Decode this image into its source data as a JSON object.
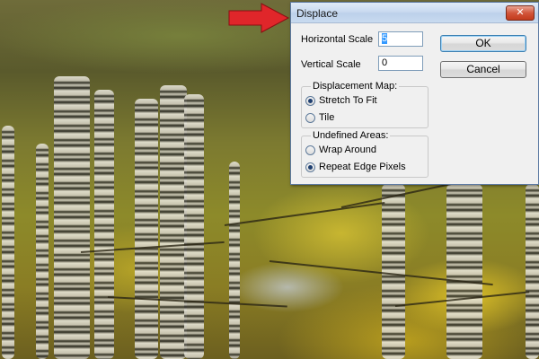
{
  "dialog": {
    "title": "Displace",
    "close_glyph": "✕",
    "horizontal_scale_label": "Horizontal Scale",
    "horizontal_scale_value": "5",
    "vertical_scale_label": "Vertical Scale",
    "vertical_scale_value": "0",
    "displacement_map": {
      "legend": "Displacement Map:",
      "options": [
        "Stretch To Fit",
        "Tile"
      ],
      "selected": "Stretch To Fit"
    },
    "undefined_areas": {
      "legend": "Undefined Areas:",
      "options": [
        "Wrap Around",
        "Repeat Edge Pixels"
      ],
      "selected": "Repeat Edge Pixels"
    },
    "ok_label": "OK",
    "cancel_label": "Cancel"
  },
  "annotation": {
    "icon": "red-arrow-icon",
    "color": "#e0262a"
  },
  "colors": {
    "titlebar": "#c9daf0",
    "dialog_bg": "#f0f0f0",
    "close_button": "#c23a1c"
  }
}
